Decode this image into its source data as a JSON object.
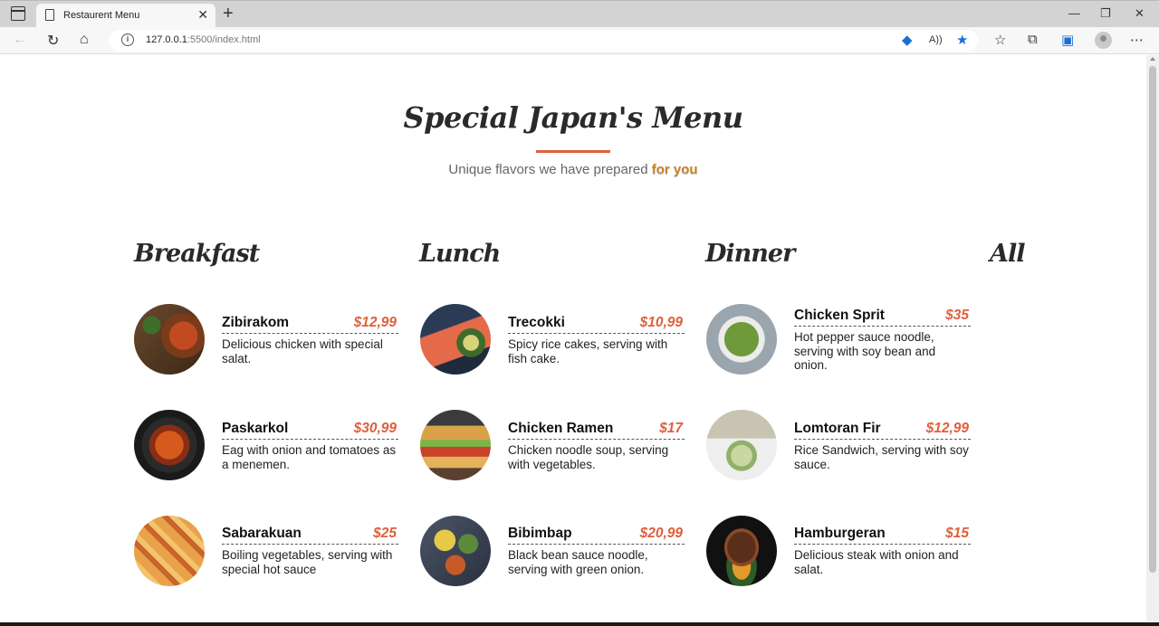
{
  "browser": {
    "tab_title": "Restaurent Menu",
    "url_host": "127.0.0.1",
    "url_path": ":5500/index.html"
  },
  "page": {
    "title": "Special Japan's Menu",
    "subtitle_prefix": "Unique flavors we have prepared ",
    "subtitle_accent": "for you",
    "accent_color": "#e0603d",
    "categories": [
      "Breakfast",
      "Lunch",
      "Dinner",
      "All"
    ],
    "columns": [
      {
        "items": [
          {
            "name": "Zibirakom",
            "price": "$12,99",
            "desc": "Delicious chicken with special salat."
          },
          {
            "name": "Paskarkol",
            "price": "$30,99",
            "desc": "Eag with onion and tomatoes as a menemen."
          },
          {
            "name": "Sabarakuan",
            "price": "$25",
            "desc": "Boiling vegetables, serving with special hot sauce"
          }
        ]
      },
      {
        "items": [
          {
            "name": "Trecokki",
            "price": "$10,99",
            "desc": "Spicy rice cakes, serving with fish cake."
          },
          {
            "name": "Chicken Ramen",
            "price": "$17",
            "desc": "Chicken noodle soup, serving with vegetables."
          },
          {
            "name": "Bibimbap",
            "price": "$20,99",
            "desc": "Black bean sauce noodle, serving with green onion."
          }
        ]
      },
      {
        "items": [
          {
            "name": "Chicken Sprit",
            "price": "$35",
            "desc": "Hot pepper sauce noodle, serving with soy bean and onion."
          },
          {
            "name": "Lomtoran Fir",
            "price": "$12,99",
            "desc": "Rice Sandwich, serving with soy sauce."
          },
          {
            "name": "Hamburgeran",
            "price": "$15",
            "desc": "Delicious steak with onion and salat."
          }
        ]
      }
    ]
  }
}
